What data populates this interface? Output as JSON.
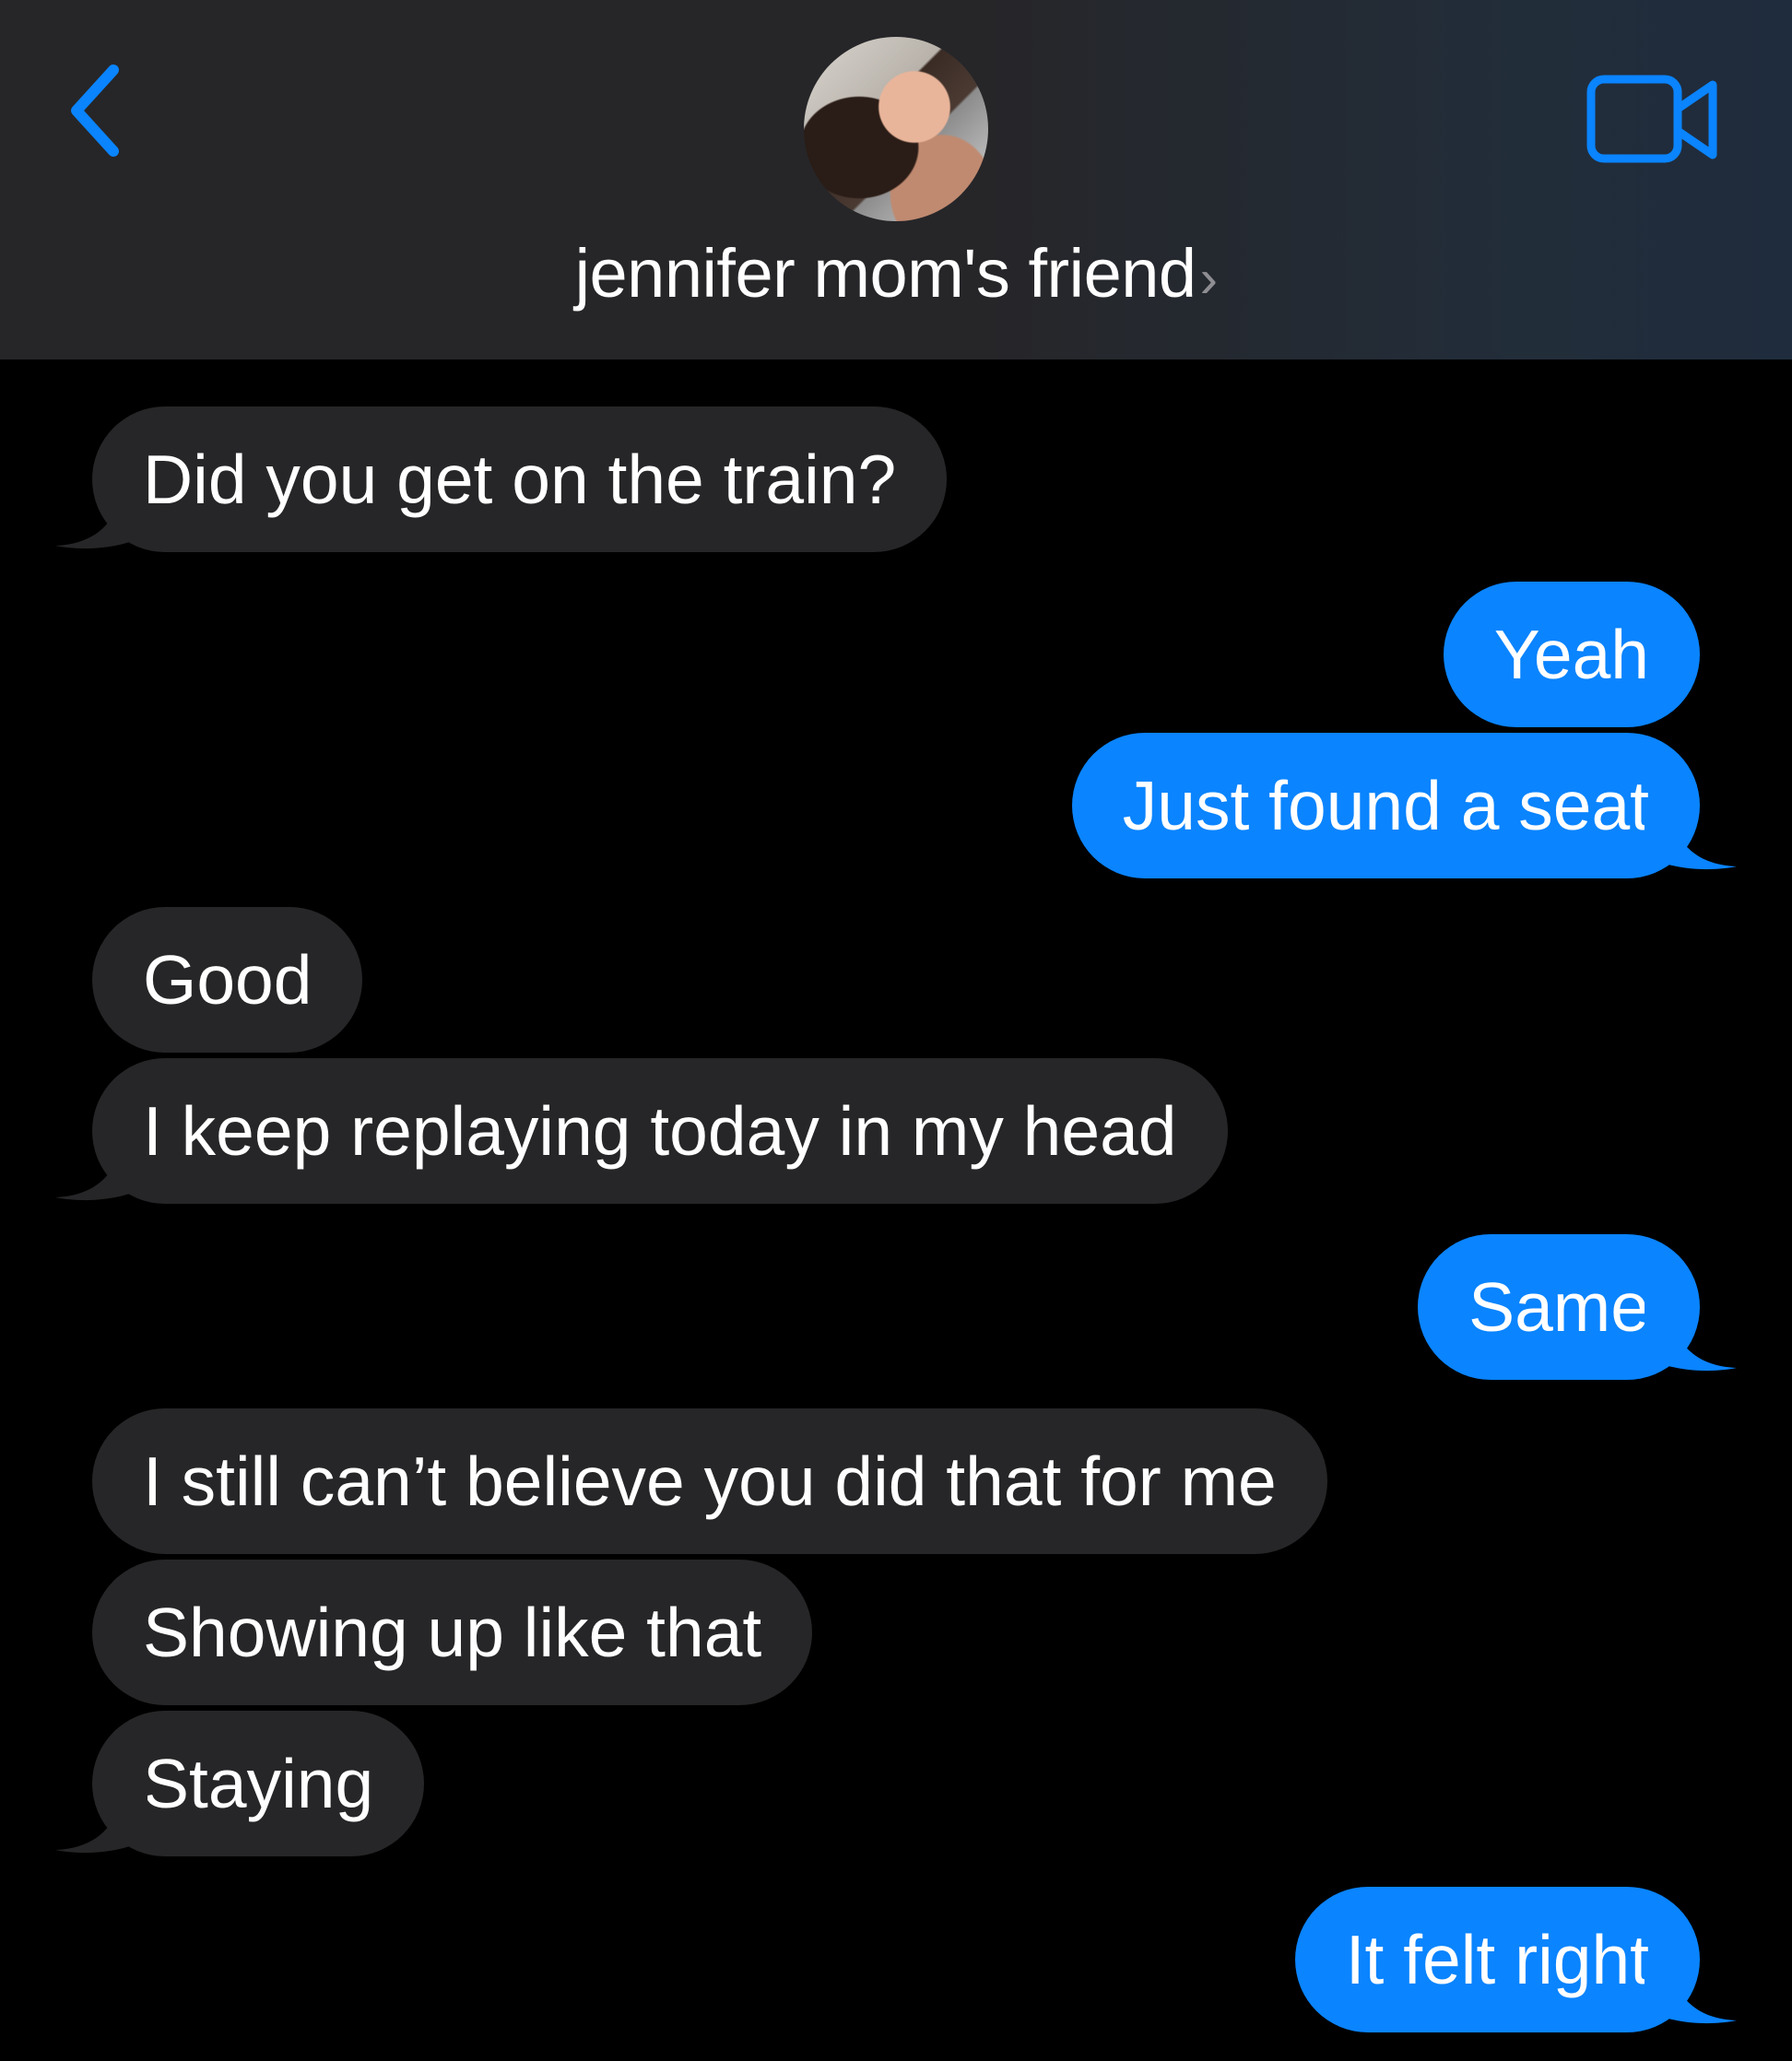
{
  "header": {
    "contact_name": "jennifer mom's friend",
    "name_chevron": "›",
    "back_icon": "chevron-left-icon",
    "video_icon": "video-camera-icon",
    "accent_color": "#0a84ff"
  },
  "messages": [
    {
      "side": "incoming",
      "text": "Did you get on the train?"
    },
    {
      "side": "outgoing",
      "text": "Yeah"
    },
    {
      "side": "outgoing",
      "text": "Just found a seat"
    },
    {
      "side": "incoming",
      "text": "Good"
    },
    {
      "side": "incoming",
      "text": "I keep replaying today in my head"
    },
    {
      "side": "outgoing",
      "text": "Same"
    },
    {
      "side": "incoming",
      "text": "I still can’t believe you did that for me"
    },
    {
      "side": "incoming",
      "text": "Showing up like that"
    },
    {
      "side": "incoming",
      "text": "Staying"
    },
    {
      "side": "outgoing",
      "text": "It felt right"
    }
  ],
  "colors": {
    "incoming_bubble": "#262628",
    "outgoing_bubble": "#0a84ff",
    "background": "#000000"
  }
}
